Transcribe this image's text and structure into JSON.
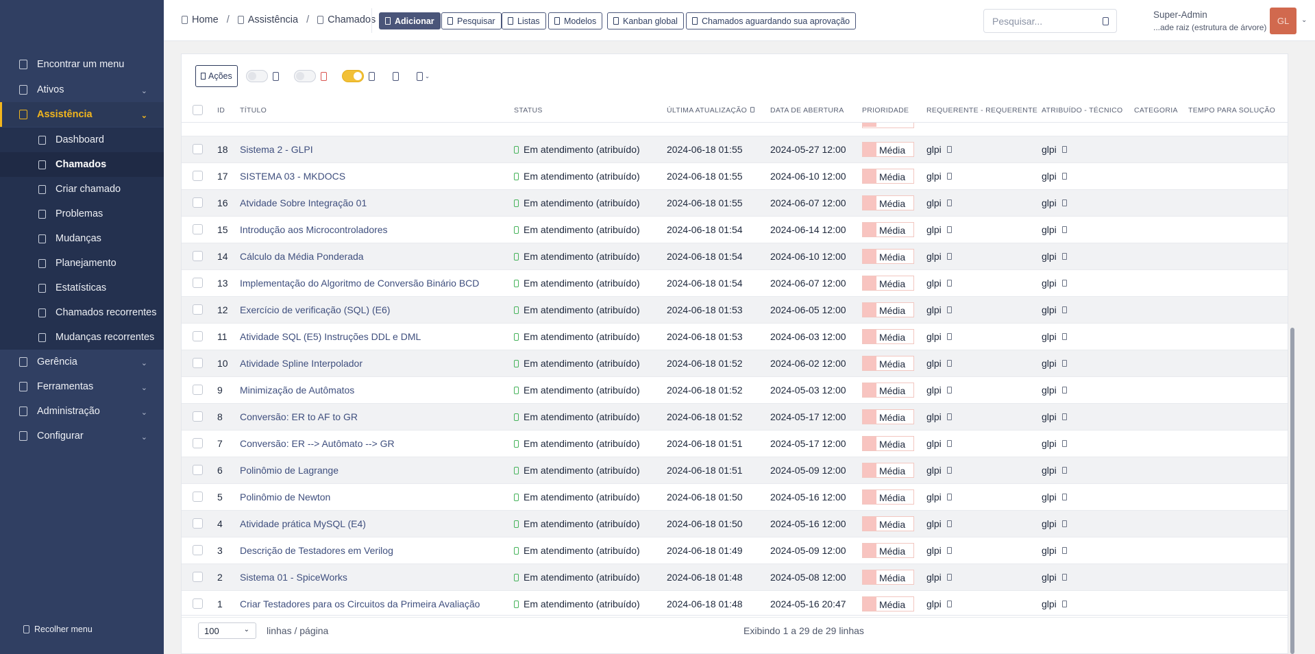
{
  "sidebar": {
    "find_menu": "Encontrar um menu",
    "items": [
      {
        "label": "Ativos"
      },
      {
        "label": "Assistência"
      },
      {
        "label": "Gerência"
      },
      {
        "label": "Ferramentas"
      },
      {
        "label": "Administração"
      },
      {
        "label": "Configurar"
      }
    ],
    "submenu": [
      {
        "label": "Dashboard"
      },
      {
        "label": "Chamados"
      },
      {
        "label": "Criar chamado"
      },
      {
        "label": "Problemas"
      },
      {
        "label": "Mudanças"
      },
      {
        "label": "Planejamento"
      },
      {
        "label": "Estatísticas"
      },
      {
        "label": "Chamados recorrentes"
      },
      {
        "label": "Mudanças recorrentes"
      }
    ],
    "collapse": "Recolher menu"
  },
  "breadcrumb": [
    "Home",
    "Assistência",
    "Chamados"
  ],
  "toolbar": {
    "add": "Adicionar",
    "search": "Pesquisar",
    "lists": "Listas",
    "models": "Modelos",
    "kanban": "Kanban global",
    "awaiting": "Chamados aguardando sua aprovação"
  },
  "search": {
    "placeholder": "Pesquisar..."
  },
  "user": {
    "name": "Super-Admin",
    "entity": "...ade raiz (estrutura de árvore)",
    "initials": "GL"
  },
  "massive": {
    "actions": "Ações"
  },
  "columns": {
    "id": "ID",
    "title": "TÍTULO",
    "status": "STATUS",
    "updated": "ÚLTIMA ATUALIZAÇÃO",
    "opened": "DATA DE ABERTURA",
    "priority": "PRIORIDADE",
    "requester": "REQUERENTE - REQUERENTE",
    "assigned": "ATRIBUÍDO - TÉCNICO",
    "category": "CATEGORIA",
    "solve_time": "TEMPO PARA SOLUÇÃO"
  },
  "rows": [
    {
      "id": "18",
      "title": "Sistema 2 - GLPI",
      "status": "Em atendimento (atribuído)",
      "updated": "2024-06-18 01:55",
      "opened": "2024-05-27 12:00",
      "priority": "Média",
      "requester": "glpi",
      "assigned": "glpi"
    },
    {
      "id": "17",
      "title": "SISTEMA 03 - MKDOCS",
      "status": "Em atendimento (atribuído)",
      "updated": "2024-06-18 01:55",
      "opened": "2024-06-10 12:00",
      "priority": "Média",
      "requester": "glpi",
      "assigned": "glpi"
    },
    {
      "id": "16",
      "title": "Atvidade Sobre Integração 01",
      "status": "Em atendimento (atribuído)",
      "updated": "2024-06-18 01:55",
      "opened": "2024-06-07 12:00",
      "priority": "Média",
      "requester": "glpi",
      "assigned": "glpi"
    },
    {
      "id": "15",
      "title": "Introdução aos Microcontroladores",
      "status": "Em atendimento (atribuído)",
      "updated": "2024-06-18 01:54",
      "opened": "2024-06-14 12:00",
      "priority": "Média",
      "requester": "glpi",
      "assigned": "glpi"
    },
    {
      "id": "14",
      "title": "Cálculo da Média Ponderada",
      "status": "Em atendimento (atribuído)",
      "updated": "2024-06-18 01:54",
      "opened": "2024-06-10 12:00",
      "priority": "Média",
      "requester": "glpi",
      "assigned": "glpi"
    },
    {
      "id": "13",
      "title": "Implementação do Algoritmo de Conversão Binário BCD",
      "status": "Em atendimento (atribuído)",
      "updated": "2024-06-18 01:54",
      "opened": "2024-06-07 12:00",
      "priority": "Média",
      "requester": "glpi",
      "assigned": "glpi"
    },
    {
      "id": "12",
      "title": "Exercício de verificação (SQL) (E6)",
      "status": "Em atendimento (atribuído)",
      "updated": "2024-06-18 01:53",
      "opened": "2024-06-05 12:00",
      "priority": "Média",
      "requester": "glpi",
      "assigned": "glpi"
    },
    {
      "id": "11",
      "title": "Atividade SQL (E5) Instruções DDL e DML",
      "status": "Em atendimento (atribuído)",
      "updated": "2024-06-18 01:53",
      "opened": "2024-06-03 12:00",
      "priority": "Média",
      "requester": "glpi",
      "assigned": "glpi"
    },
    {
      "id": "10",
      "title": "Atividade Spline Interpolador",
      "status": "Em atendimento (atribuído)",
      "updated": "2024-06-18 01:52",
      "opened": "2024-06-02 12:00",
      "priority": "Média",
      "requester": "glpi",
      "assigned": "glpi"
    },
    {
      "id": "9",
      "title": "Minimização de Autômatos",
      "status": "Em atendimento (atribuído)",
      "updated": "2024-06-18 01:52",
      "opened": "2024-05-03 12:00",
      "priority": "Média",
      "requester": "glpi",
      "assigned": "glpi"
    },
    {
      "id": "8",
      "title": "Conversão: ER to AF to GR",
      "status": "Em atendimento (atribuído)",
      "updated": "2024-06-18 01:52",
      "opened": "2024-05-17 12:00",
      "priority": "Média",
      "requester": "glpi",
      "assigned": "glpi"
    },
    {
      "id": "7",
      "title": "Conversão: ER --> Autômato --> GR",
      "status": "Em atendimento (atribuído)",
      "updated": "2024-06-18 01:51",
      "opened": "2024-05-17 12:00",
      "priority": "Média",
      "requester": "glpi",
      "assigned": "glpi"
    },
    {
      "id": "6",
      "title": "Polinômio de Lagrange",
      "status": "Em atendimento (atribuído)",
      "updated": "2024-06-18 01:51",
      "opened": "2024-05-09 12:00",
      "priority": "Média",
      "requester": "glpi",
      "assigned": "glpi"
    },
    {
      "id": "5",
      "title": "Polinômio de Newton",
      "status": "Em atendimento (atribuído)",
      "updated": "2024-06-18 01:50",
      "opened": "2024-05-16 12:00",
      "priority": "Média",
      "requester": "glpi",
      "assigned": "glpi"
    },
    {
      "id": "4",
      "title": "Atividade prática MySQL (E4)",
      "status": "Em atendimento (atribuído)",
      "updated": "2024-06-18 01:50",
      "opened": "2024-05-16 12:00",
      "priority": "Média",
      "requester": "glpi",
      "assigned": "glpi"
    },
    {
      "id": "3",
      "title": "Descrição de Testadores em Verilog",
      "status": "Em atendimento (atribuído)",
      "updated": "2024-06-18 01:49",
      "opened": "2024-05-09 12:00",
      "priority": "Média",
      "requester": "glpi",
      "assigned": "glpi"
    },
    {
      "id": "2",
      "title": "Sistema 01 - SpiceWorks",
      "status": "Em atendimento (atribuído)",
      "updated": "2024-06-18 01:48",
      "opened": "2024-05-08 12:00",
      "priority": "Média",
      "requester": "glpi",
      "assigned": "glpi"
    },
    {
      "id": "1",
      "title": "Criar Testadores para os Circuitos da Primeira Avaliação",
      "status": "Em atendimento (atribuído)",
      "updated": "2024-06-18 01:48",
      "opened": "2024-05-16 20:47",
      "priority": "Média",
      "requester": "glpi",
      "assigned": "glpi"
    }
  ],
  "pagination": {
    "per_page": "100",
    "per_page_label": "linhas / página",
    "showing": "Exibindo 1 a 29 de 29 linhas"
  },
  "colors": {
    "sidebar": "#303f62",
    "accent": "#f2b61d",
    "priority_medium": "#f8c4c0",
    "status_icon": "#45b35a"
  }
}
